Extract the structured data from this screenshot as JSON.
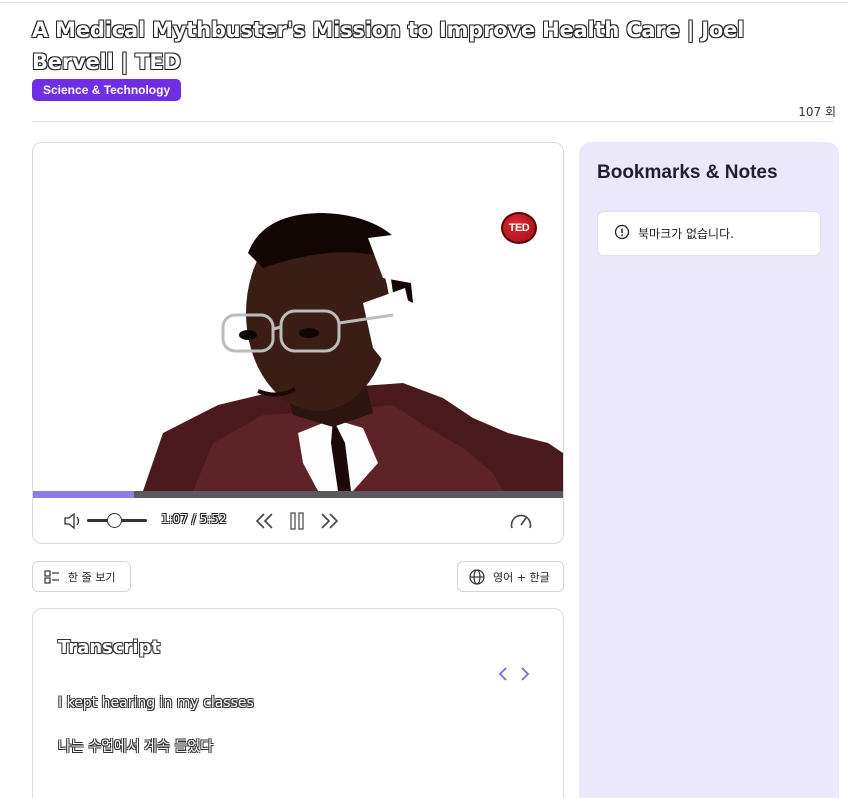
{
  "video": {
    "title": "A Medical Mythbuster's Mission to Improve Health Care | Joel Bervell | TED",
    "category": "Science & Technology",
    "views": "107 회",
    "brand_logo_text": "TED",
    "progress_fraction": 0.19,
    "volume_fraction": 0.45,
    "time_display": "1:07 / 5:52"
  },
  "toolbar": {
    "single_line_label": "한 줄 보기",
    "language_label": "영어 + 한글"
  },
  "transcript": {
    "heading": "Transcript",
    "line_en": "I kept hearing in my classes",
    "line_ko": "나는 수업에서 계속 들었다"
  },
  "bookmarks": {
    "title": "Bookmarks & Notes",
    "empty_message": "북마크가 없습니다."
  },
  "colors": {
    "accent": "#6f2ee6",
    "progress": "#8f7be6",
    "panel_bg": "#ece8fc",
    "ted_red": "#e0272e"
  },
  "icons": [
    "volume-icon",
    "rewind-icon",
    "pause-icon",
    "forward-icon",
    "speed-icon",
    "list-icon",
    "globe-icon",
    "chevron-left-icon",
    "chevron-right-icon",
    "info-icon"
  ]
}
